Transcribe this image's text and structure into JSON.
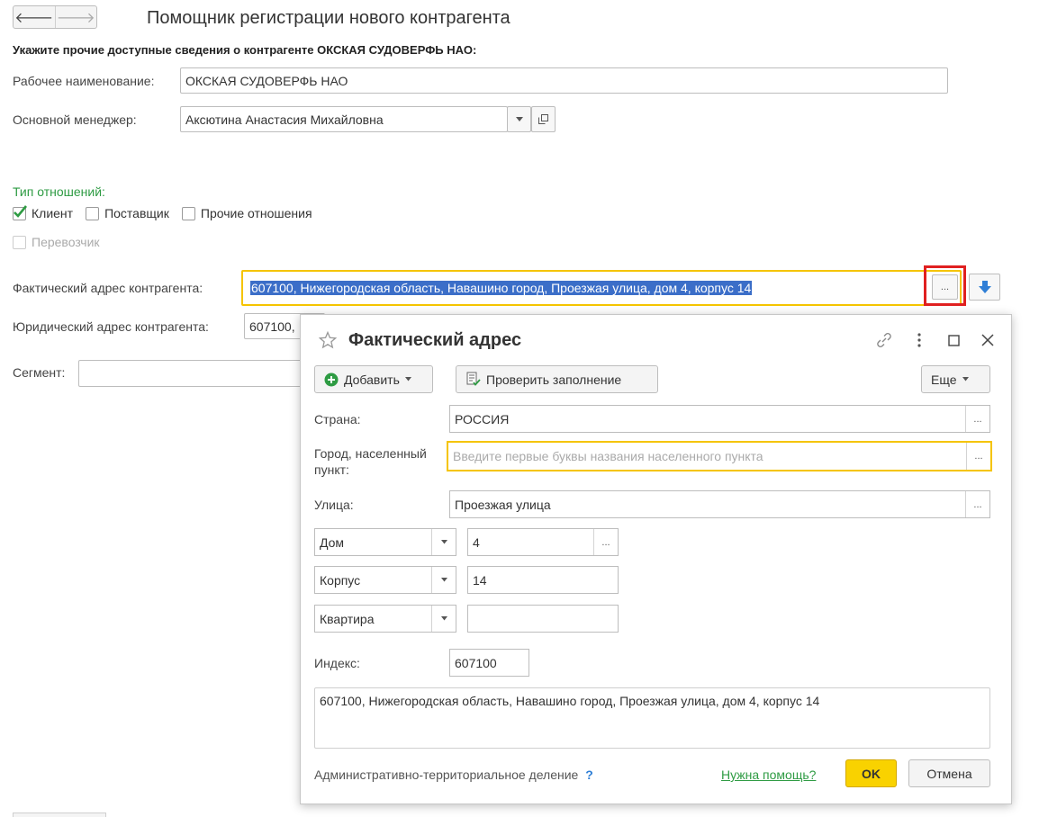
{
  "header": {
    "title": "Помощник регистрации нового контрагента",
    "subtitle": "Укажите прочие доступные сведения о контрагенте ОКСКАЯ СУДОВЕРФЬ НАО:",
    "back_glyph": "🡐",
    "forward_glyph": "🡒"
  },
  "form": {
    "work_name_label": "Рабочее наименование:",
    "work_name_value": "ОКСКАЯ СУДОВЕРФЬ НАО",
    "manager_label": "Основной менеджер:",
    "manager_value": "Аксютина Анастасия Михайловна",
    "relations_title": "Тип отношений:",
    "relations": [
      {
        "label": "Клиент",
        "checked": true
      },
      {
        "label": "Поставщик",
        "checked": false
      },
      {
        "label": "Прочие отношения",
        "checked": false
      }
    ],
    "carrier_label": "Перевозчик",
    "actual_address_label": "Фактический адрес контрагента:",
    "actual_address_value": "607100, Нижегородская область, Навашино город, Проезжая улица, дом 4, корпус 14",
    "legal_address_label": "Юридический адрес контрагента:",
    "legal_address_value": "607100,",
    "segment_label": "Сегмент:",
    "ellipsis": "..."
  },
  "dialog": {
    "title": "Фактический адрес",
    "add_button": "Добавить",
    "check_button": "Проверить заполнение",
    "more_button": "Еще",
    "country_label": "Страна:",
    "country_value": "РОССИЯ",
    "city_label": "Город, населенный пункт:",
    "city_placeholder": "Введите первые буквы названия населенного пункта",
    "street_label": "Улица:",
    "street_value": "Проезжая улица",
    "house_type": "Дом",
    "house_value": "4",
    "building_type": "Корпус",
    "building_value": "14",
    "apartment_type": "Квартира",
    "apartment_value": "",
    "index_label": "Индекс:",
    "index_value": "607100",
    "full_address": "607100, Нижегородская область, Навашино город, Проезжая улица, дом 4, корпус 14",
    "admin_division_label": "Административно-территориальное деление",
    "admin_question": "?",
    "help_link": "Нужна помощь?",
    "ok_button": "OK",
    "cancel_button": "Отмена",
    "ellipsis": "..."
  },
  "colors": {
    "accent_green": "#2e9b43",
    "selection_blue": "#3b6ec8",
    "highlight_red": "#e02020",
    "focus_yellow": "#f5c400",
    "ok_yellow": "#f9d200"
  }
}
